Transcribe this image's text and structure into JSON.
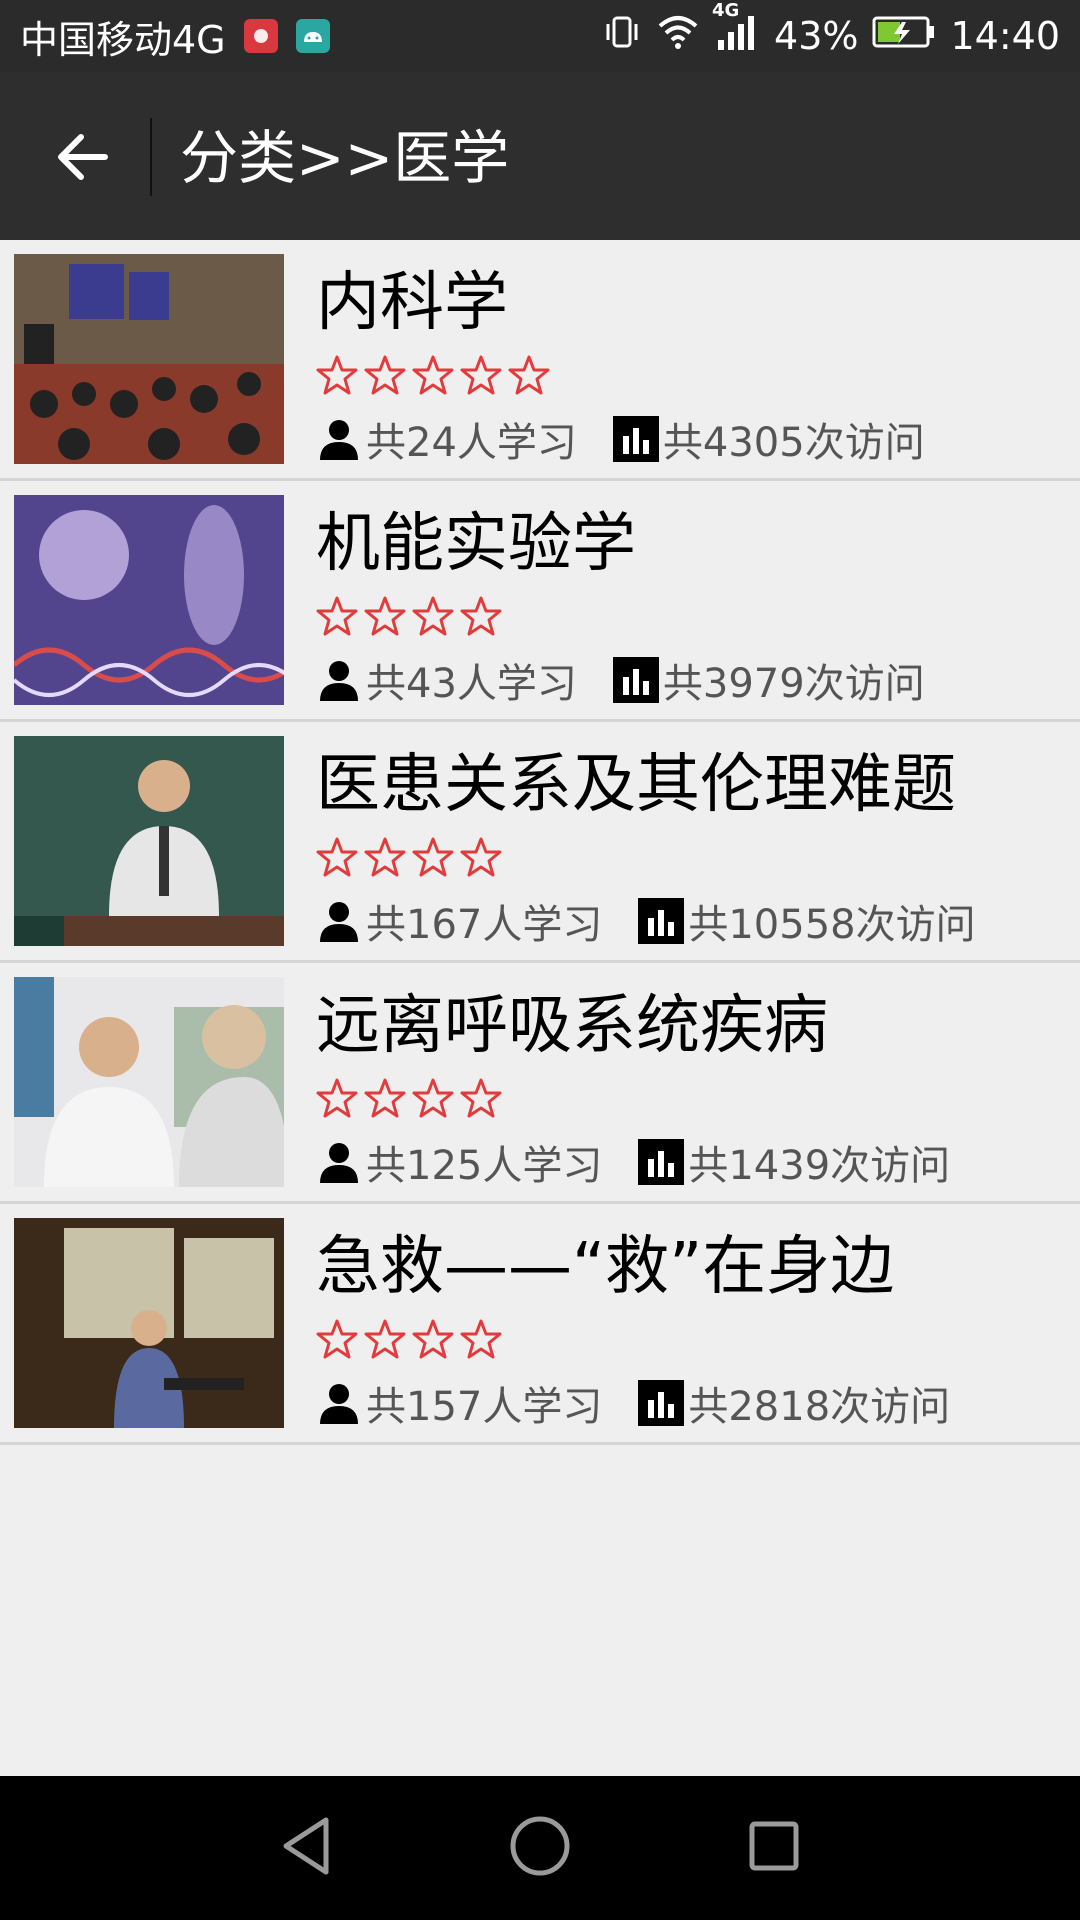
{
  "status_bar": {
    "carrier": "中国移动4G",
    "battery_percent": "43%",
    "time": "14:40",
    "network": "4G",
    "icons": [
      "huawei-app-icon",
      "android-icon",
      "vibrate-icon",
      "wifi-icon",
      "signal-icon",
      "battery-charging-icon"
    ]
  },
  "toolbar": {
    "title": "分类>>医学",
    "back_icon": "arrow-left-icon"
  },
  "colors": {
    "star": "#e23b3b",
    "toolbar_bg": "#2e2e2e",
    "status_bg": "#2b2b2b",
    "list_bg": "#efeff0"
  },
  "courses": [
    {
      "title": "内科学",
      "stars": 5,
      "learners": "共24人学习",
      "visits": "共4305次访问",
      "thumb_colors": [
        "#3a2a1f",
        "#8a5a3a",
        "#3b3b8f"
      ]
    },
    {
      "title": "机能实验学",
      "stars": 4,
      "learners": "共43人学习",
      "visits": "共3979次访问",
      "thumb_colors": [
        "#2b2a6b",
        "#7a5fb0",
        "#c9b8e8"
      ]
    },
    {
      "title": "医患关系及其伦理难题",
      "stars": 4,
      "learners": "共167人学习",
      "visits": "共10558次访问",
      "thumb_colors": [
        "#1e3b34",
        "#35584e",
        "#e6e6e6"
      ]
    },
    {
      "title": "远离呼吸系统疾病",
      "stars": 4,
      "learners": "共125人学习",
      "visits": "共1439次访问",
      "thumb_colors": [
        "#4a7ba0",
        "#e8e8ea",
        "#6c8f6a"
      ]
    },
    {
      "title": "急救——“救”在身边",
      "stars": 4,
      "learners": "共157人学习",
      "visits": "共2818次访问",
      "thumb_colors": [
        "#3b2a1a",
        "#c8c2a8",
        "#6a5a40"
      ]
    }
  ],
  "nav_bar": {
    "icons": [
      "back-triangle-icon",
      "home-circle-icon",
      "recents-square-icon"
    ]
  }
}
